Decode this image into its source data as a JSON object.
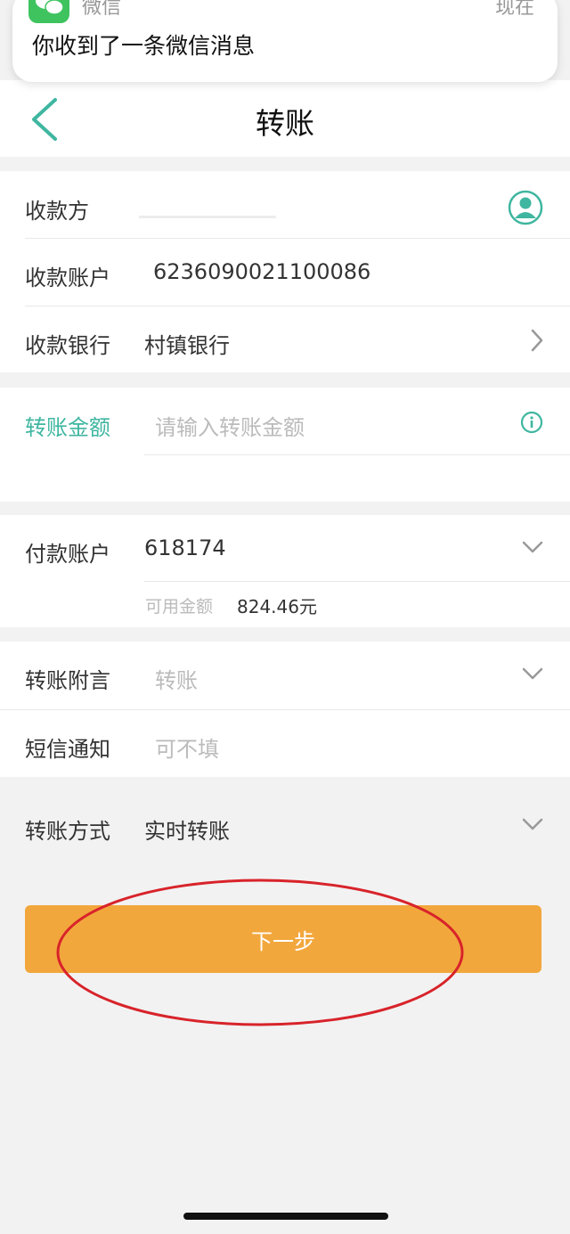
{
  "notification": {
    "app_name": "微信",
    "time": "现在",
    "message": "你收到了一条微信消息"
  },
  "header": {
    "title": "转账"
  },
  "payee_section": {
    "payee_label": "收款方",
    "account_label": "收款账户",
    "account_value": "6236090021100086",
    "bank_label": "收款银行",
    "bank_value": "村镇银行"
  },
  "amount_section": {
    "amount_label": "转账金额",
    "amount_placeholder": "请输入转账金额"
  },
  "payer_section": {
    "payer_label": "付款账户",
    "payer_value": "618174",
    "available_label": "可用金额",
    "available_value": "824.46元"
  },
  "extra_section": {
    "remark_label": "转账附言",
    "remark_placeholder": "转账",
    "sms_label": "短信通知",
    "sms_placeholder": "可不填"
  },
  "method": {
    "label": "转账方式",
    "value": "实时转账"
  },
  "next_button": {
    "label": "下一步"
  },
  "colors": {
    "accent": "#3fb6a0",
    "button": "#f2a73d",
    "annotation": "#d8232a"
  },
  "icons": {
    "app": "wechat-icon",
    "back": "back-arrow-icon",
    "contact": "contact-icon",
    "info": "info-icon",
    "chevron_right": "chevron-right-icon",
    "chevron_down": "chevron-down-icon"
  }
}
